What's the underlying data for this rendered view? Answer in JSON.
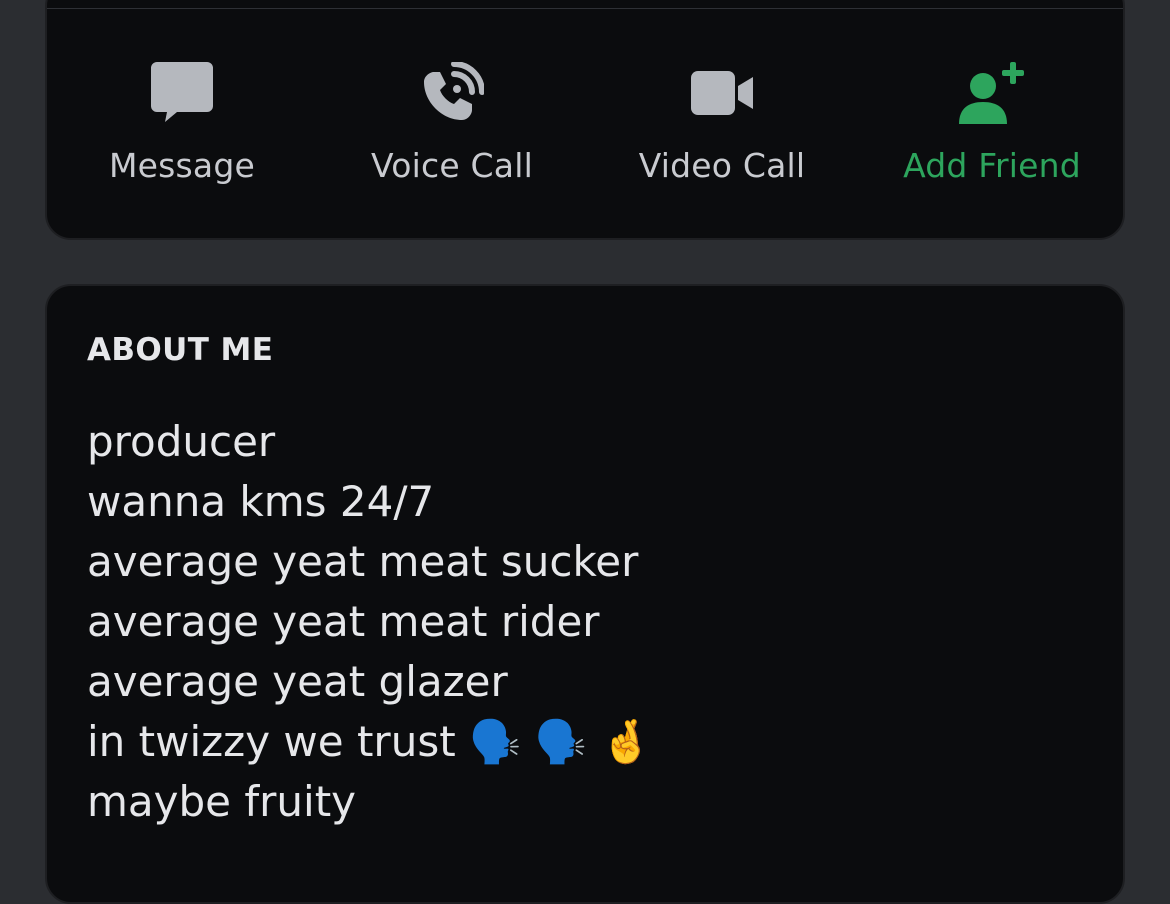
{
  "actions": {
    "message": {
      "label": "Message",
      "icon": "message-bubble-icon"
    },
    "voice_call": {
      "label": "Voice Call",
      "icon": "phone-call-icon"
    },
    "video_call": {
      "label": "Video Call",
      "icon": "video-camera-icon"
    },
    "add_friend": {
      "label": "Add Friend",
      "icon": "add-user-icon"
    }
  },
  "colors": {
    "background": "#2b2d31",
    "card": "#0b0c0e",
    "action_icon": "#b5b8be",
    "add_friend_accent": "#2da55d",
    "text": "#e6e7ea"
  },
  "about": {
    "title": "ABOUT ME",
    "lines": [
      "producer",
      "wanna kms 24/7",
      "average yeat meat sucker",
      "average yeat meat rider",
      "average yeat glazer",
      "in twizzy we trust 🗣️ 🗣️ 🤞",
      "maybe fruity"
    ]
  }
}
